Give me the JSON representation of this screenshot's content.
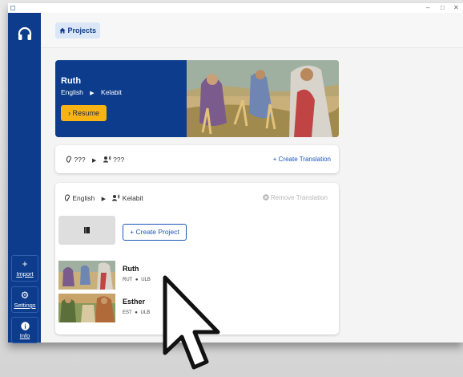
{
  "window": {
    "controls": [
      "–",
      "□",
      "✕"
    ]
  },
  "sidebar": {
    "logo_icon": "headphones-icon",
    "items": [
      {
        "label": "Import",
        "icon": "plus-icon",
        "glyph": "+"
      },
      {
        "label": "Settings",
        "icon": "gear-icon",
        "glyph": "⚙"
      },
      {
        "label": "Info",
        "icon": "info-icon",
        "glyph": "i"
      }
    ]
  },
  "topbar": {
    "projects_label": "Projects",
    "projects_icon": "home-icon"
  },
  "hero": {
    "title": "Ruth",
    "source_language": "English",
    "target_language": "Kelabit",
    "resume_label": "Resume",
    "resume_arrow": "›"
  },
  "empty_translation": {
    "source_language": "???",
    "target_language": "???",
    "create_translation_label": "Create Translation"
  },
  "translation": {
    "source_language": "English",
    "target_language": "Kelabit",
    "remove_translation_label": "Remove Translation",
    "create_project_label": "Create Project",
    "projects": [
      {
        "name": "Ruth",
        "code": "RUT",
        "version": "ULB"
      },
      {
        "name": "Esther",
        "code": "EST",
        "version": "ULB"
      }
    ]
  },
  "colors": {
    "sidebar": "#0d3c8c",
    "accent": "#1f55b6",
    "resume": "#f6b313"
  }
}
